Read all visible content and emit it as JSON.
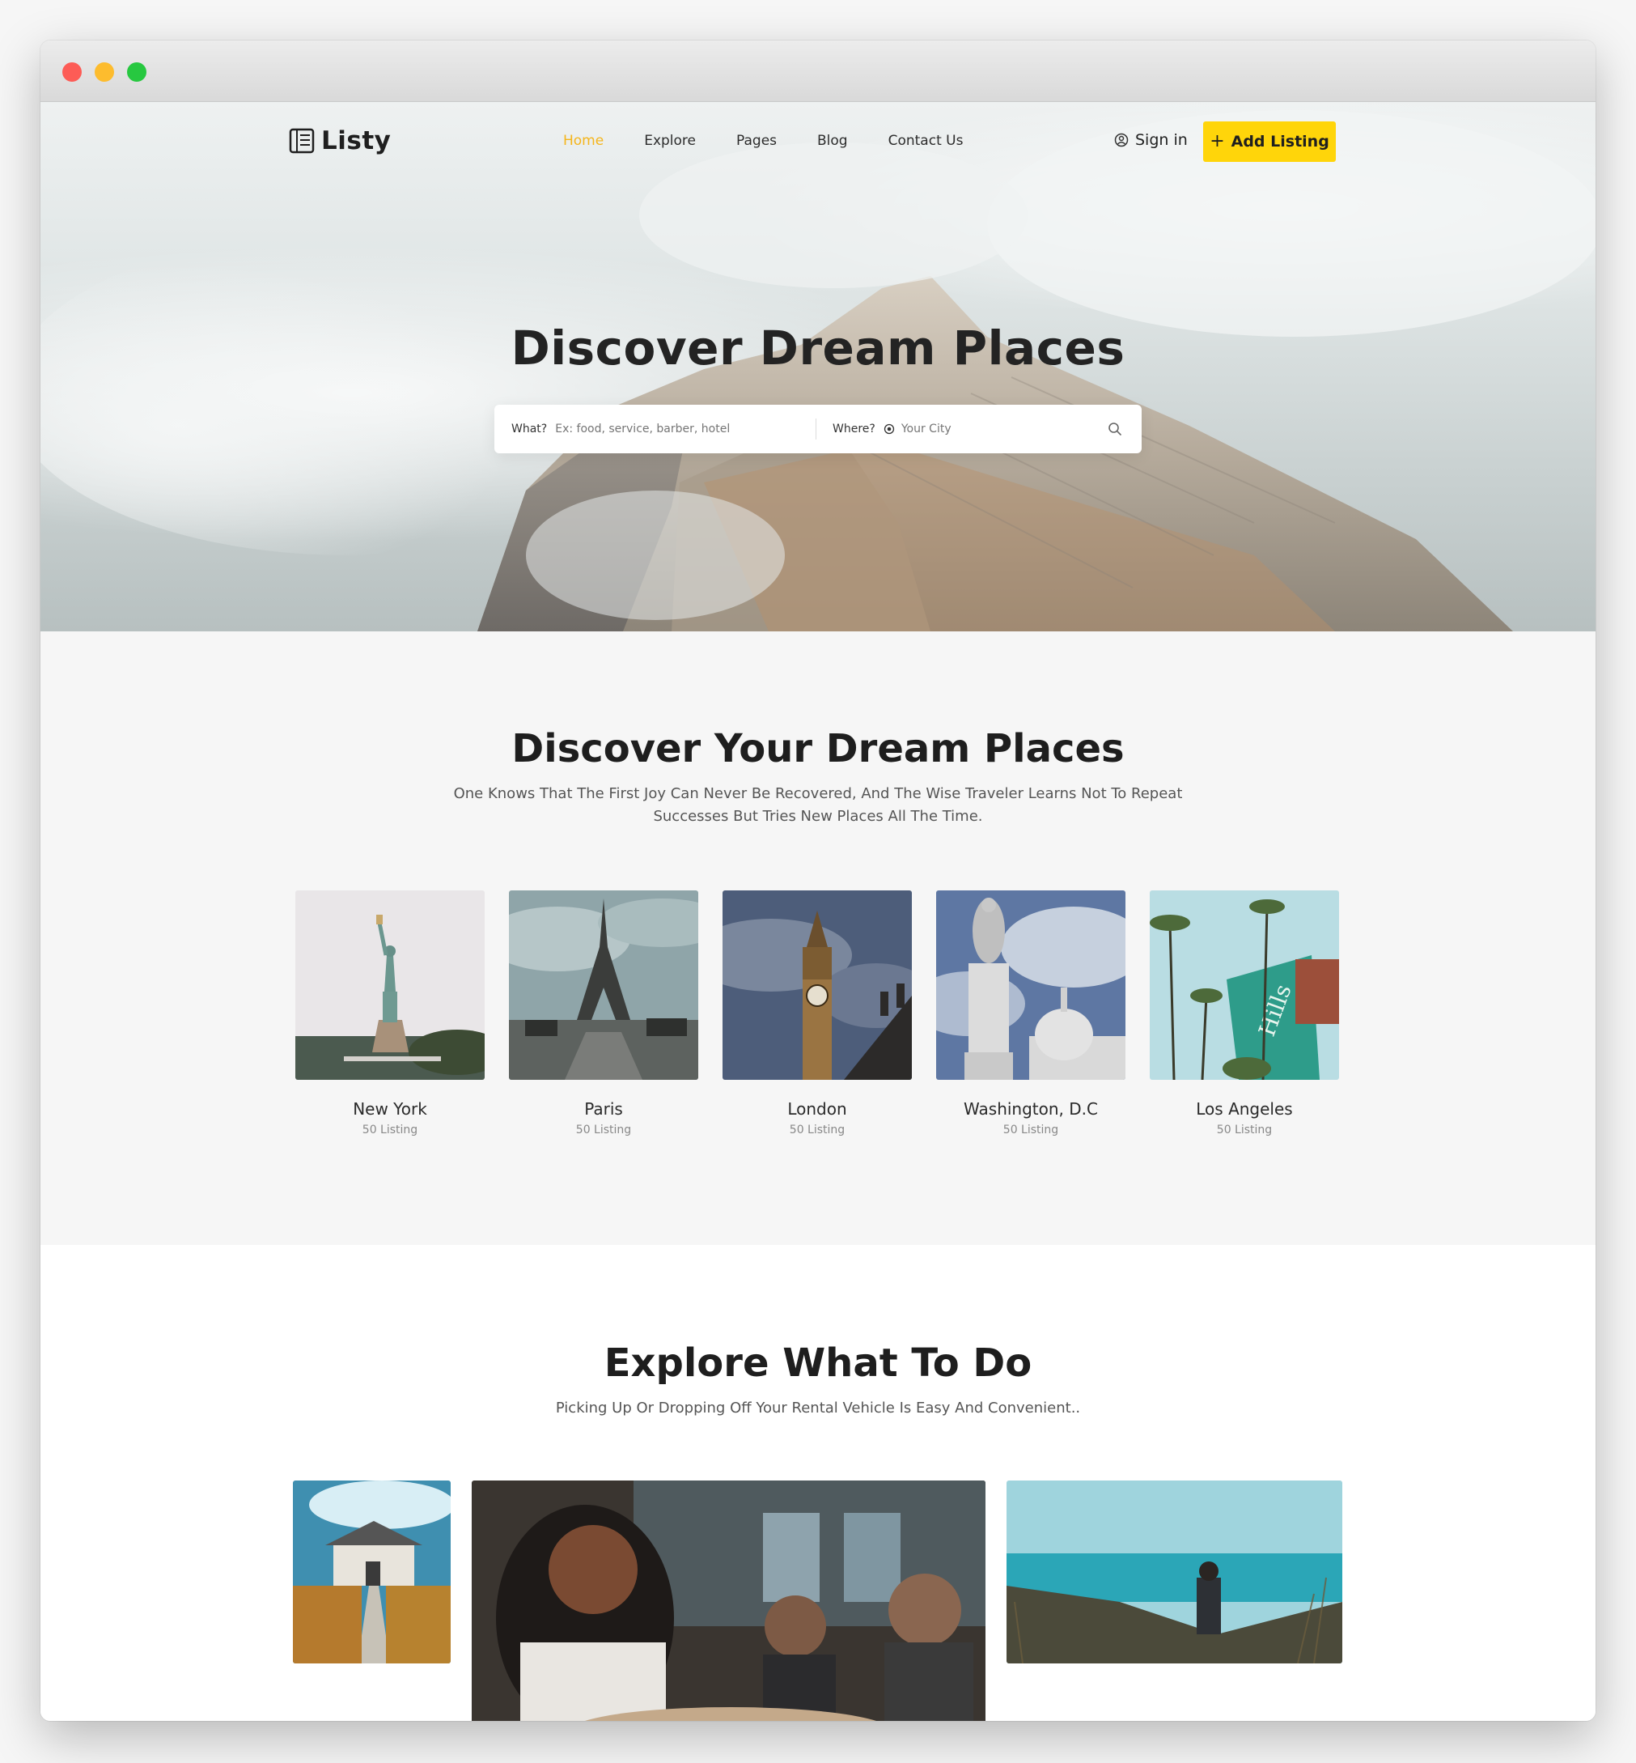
{
  "brand": {
    "name": "Listy"
  },
  "nav": {
    "items": [
      {
        "label": "Home",
        "active": true
      },
      {
        "label": "Explore"
      },
      {
        "label": "Pages"
      },
      {
        "label": "Blog"
      },
      {
        "label": "Contact Us"
      }
    ],
    "signin_label": "Sign in",
    "add_listing_label": "Add Listing"
  },
  "hero": {
    "title": "Discover Dream Places",
    "search": {
      "what_label": "What?",
      "what_placeholder": "Ex: food, service, barber, hotel",
      "where_label": "Where?",
      "where_placeholder": "Your City"
    }
  },
  "places": {
    "title": "Discover Your Dream Places",
    "subtitle": "One Knows That The First Joy Can Never Be Recovered, And The Wise Traveler Learns Not To Repeat Successes But Tries New Places All The Time.",
    "cities": [
      {
        "name": "New York",
        "count": "50 Listing"
      },
      {
        "name": "Paris",
        "count": "50 Listing"
      },
      {
        "name": "London",
        "count": "50 Listing"
      },
      {
        "name": "Washington, D.C",
        "count": "50 Listing"
      },
      {
        "name": "Los Angeles",
        "count": "50 Listing"
      }
    ]
  },
  "explore": {
    "title": "Explore What To Do",
    "subtitle": "Picking Up Or Dropping Off Your Rental Vehicle Is Easy And Convenient.."
  },
  "colors": {
    "accent": "#ffd50a",
    "active_nav": "#f5b51b",
    "heading": "#1e1e1e"
  }
}
